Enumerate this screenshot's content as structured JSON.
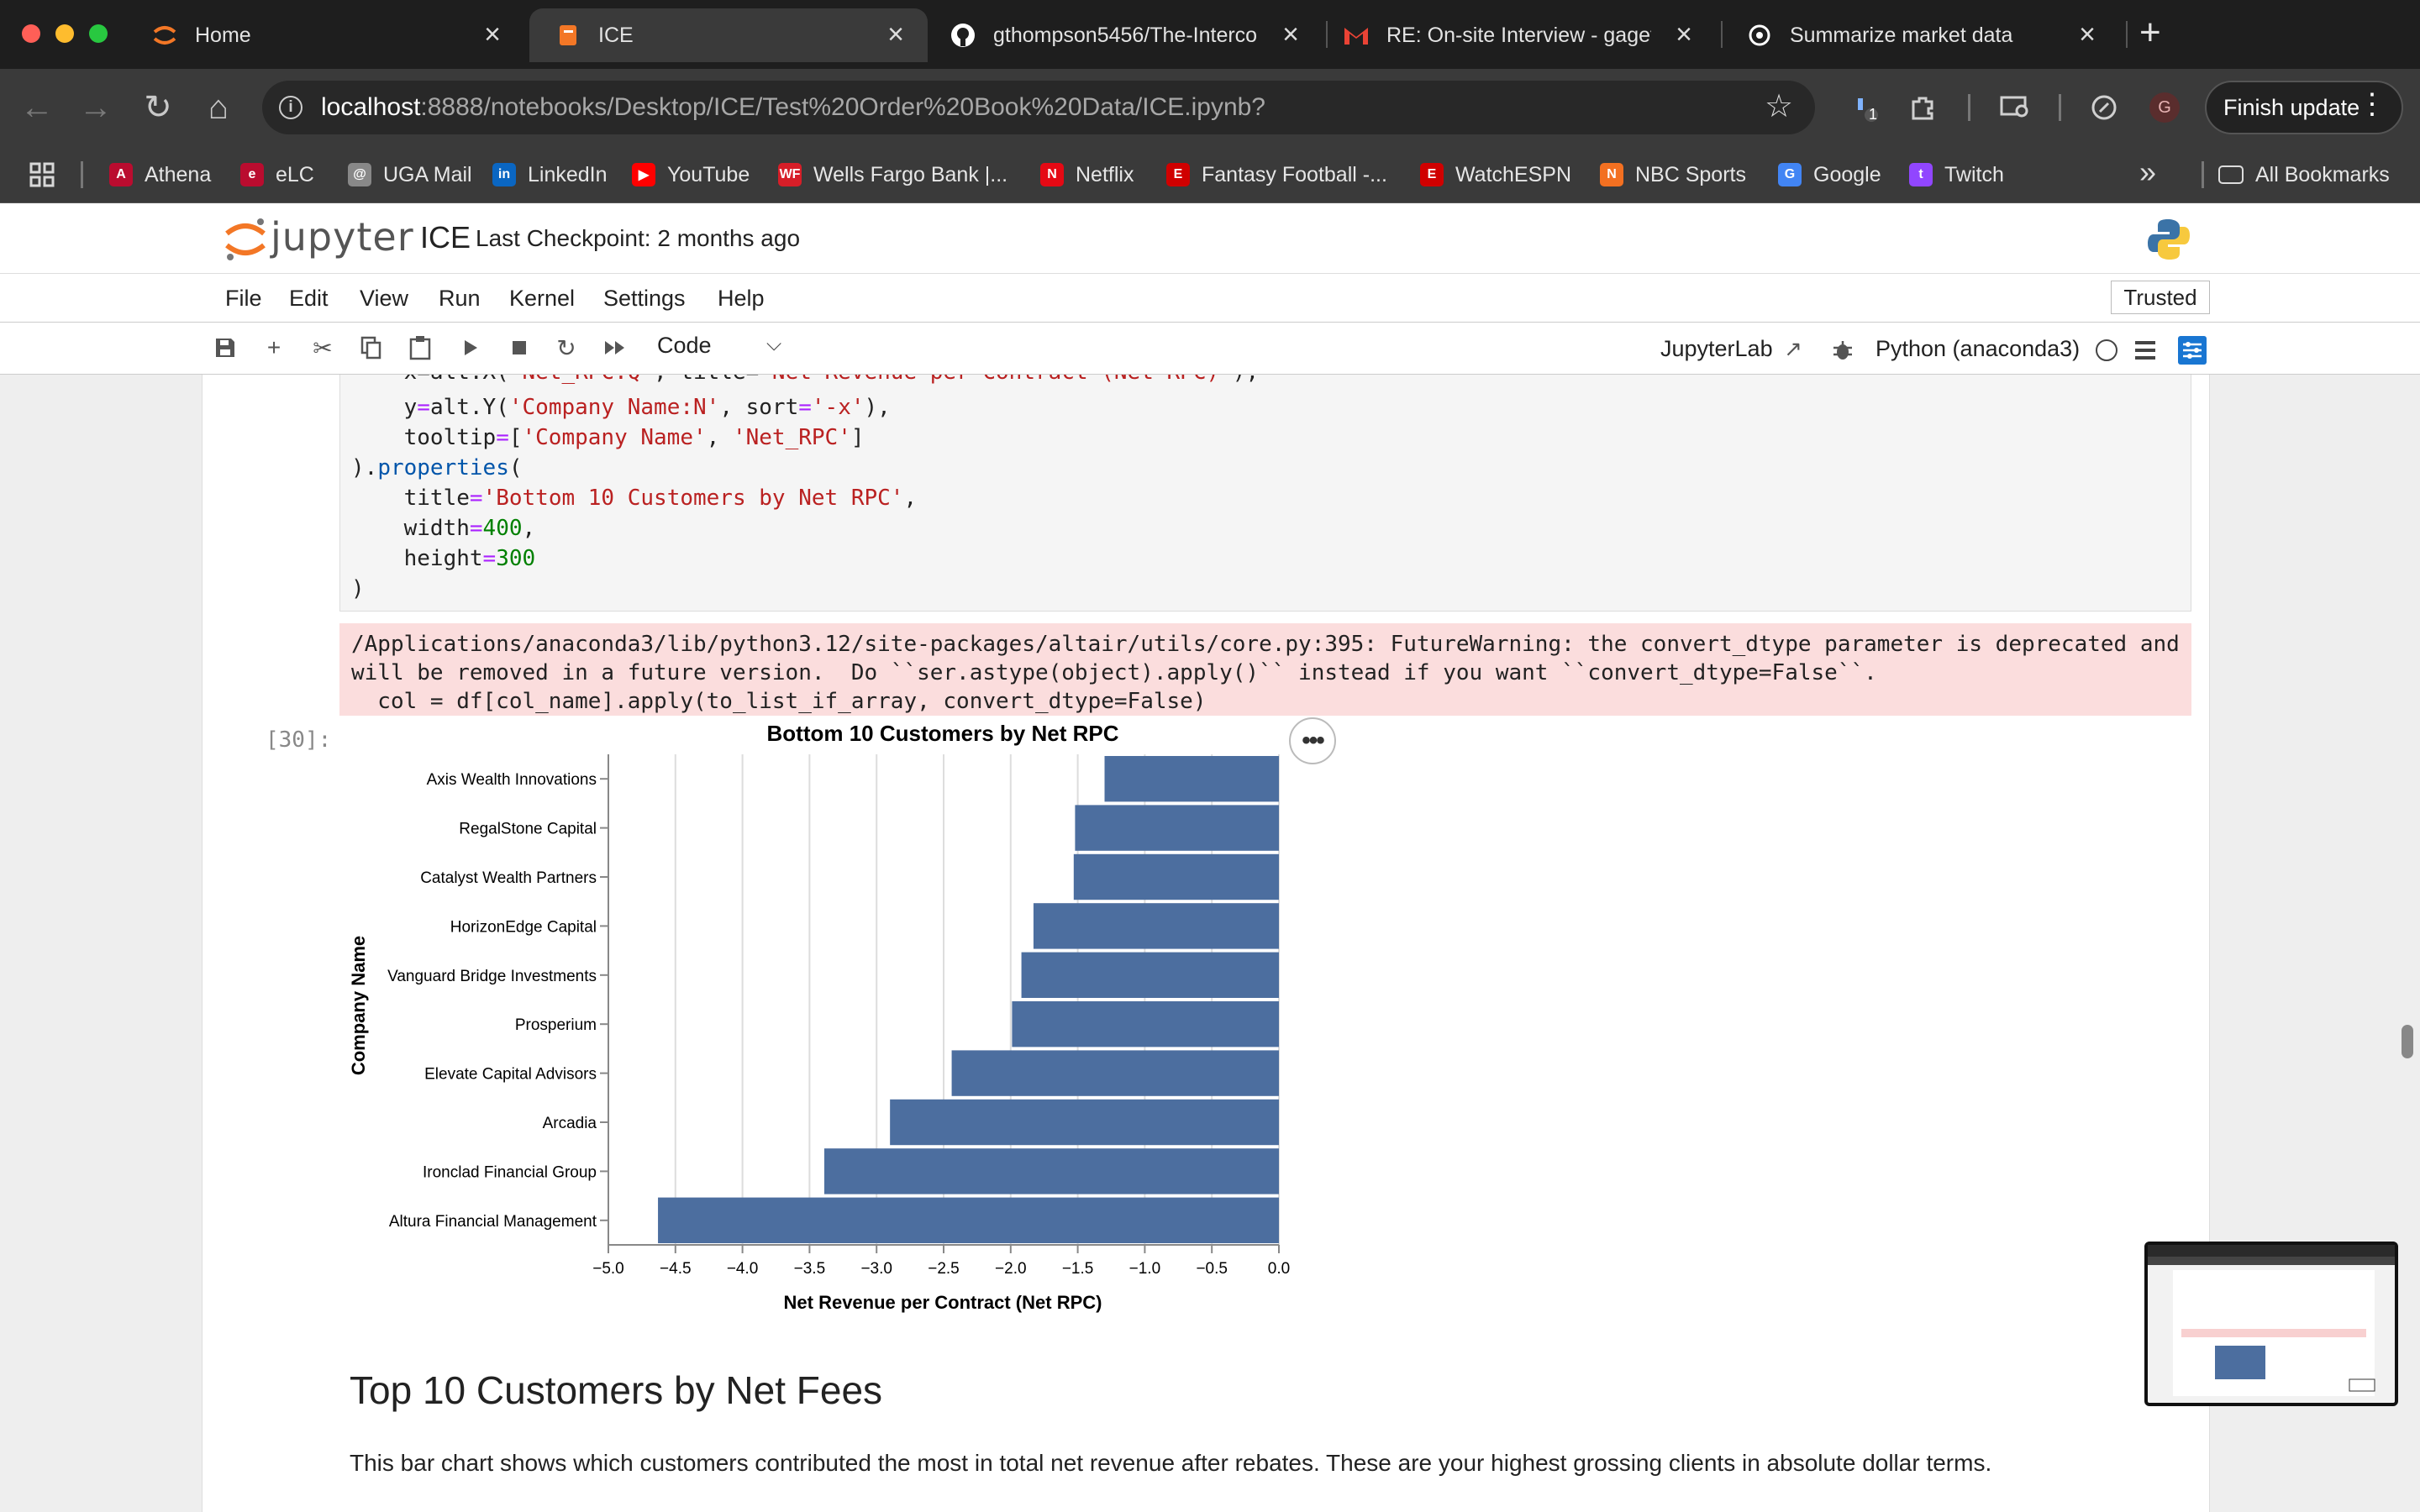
{
  "browser": {
    "tabs": [
      {
        "label": "Home",
        "icon": "jupyter-icon"
      },
      {
        "label": "ICE",
        "icon": "notebook-icon"
      },
      {
        "label": "gthompson5456/The-Interco",
        "icon": "github-icon"
      },
      {
        "label": "RE: On-site Interview - gaget",
        "icon": "gmail-icon"
      },
      {
        "label": "Summarize market data",
        "icon": "chatgpt-icon"
      }
    ],
    "new_tab": "+",
    "close_glyph": "×",
    "url_host": "localhost",
    "url_path": ":8888/notebooks/Desktop/ICE/Test%20Order%20Book%20Data/ICE.ipynb?",
    "extension_badge": "1",
    "profile_initial": "G",
    "finish_update": "Finish update",
    "bookmarks": [
      {
        "label": "Athena",
        "color": "#ba0c2f",
        "glyph": "A"
      },
      {
        "label": "eLC",
        "color": "#ba0c2f",
        "glyph": "e"
      },
      {
        "label": "UGA Mail",
        "color": "#888888",
        "glyph": "@"
      },
      {
        "label": "LinkedIn",
        "color": "#0a66c2",
        "glyph": "in"
      },
      {
        "label": "YouTube",
        "color": "#ff0000",
        "glyph": "▶"
      },
      {
        "label": "Wells Fargo Bank |...",
        "color": "#d71e28",
        "glyph": "WF"
      },
      {
        "label": "Netflix",
        "color": "#e50914",
        "glyph": "N"
      },
      {
        "label": "Fantasy Football -...",
        "color": "#d00000",
        "glyph": "E"
      },
      {
        "label": "WatchESPN",
        "color": "#d00000",
        "glyph": "E"
      },
      {
        "label": "NBC Sports",
        "color": "#f37021",
        "glyph": "N"
      },
      {
        "label": "Google",
        "color": "#4285f4",
        "glyph": "G"
      },
      {
        "label": "Twitch",
        "color": "#9146ff",
        "glyph": "t"
      }
    ],
    "more_bookmarks": "»",
    "all_bookmarks": "All Bookmarks"
  },
  "jupyter": {
    "wordmark": "jupyter",
    "notebook_name": "ICE",
    "checkpoint": "Last Checkpoint: 2 months ago",
    "menu": [
      "File",
      "Edit",
      "View",
      "Run",
      "Kernel",
      "Settings",
      "Help"
    ],
    "trusted": "Trusted",
    "cell_type": "Code",
    "jupyterlab_link": "JupyterLab",
    "kernel": "Python (anaconda3)"
  },
  "code_lines": [
    "    x=alt.X('Net_RPC:Q', title='Net Revenue per Contract (Net RPC)'),",
    "    y=alt.Y('Company Name:N', sort='-x'),",
    "    tooltip=['Company Name', 'Net_RPC']",
    ").properties(",
    "    title='Bottom 10 Customers by Net RPC',",
    "    width=400,",
    "    height=300",
    ")"
  ],
  "warning_lines": [
    "/Applications/anaconda3/lib/python3.12/site-packages/altair/utils/core.py:395: FutureWarning: the convert_dtype parameter is deprecated and",
    "will be removed in a future version.  Do ``ser.astype(object).apply()`` instead if you want ``convert_dtype=False``.",
    "  col = df[col_name].apply(to_list_if_array, convert_dtype=False)"
  ],
  "output_prompt": "[30]:",
  "chart_menu": "•••",
  "chart_data": {
    "type": "bar",
    "title": "Bottom 10 Customers by Net RPC",
    "xlabel": "Net Revenue per Contract (Net RPC)",
    "ylabel": "Company Name",
    "orientation": "horizontal",
    "categories": [
      "Axis Wealth Innovations",
      "RegalStone Capital",
      "Catalyst Wealth Partners",
      "HorizonEdge Capital",
      "Vanguard Bridge Investments",
      "Prosperium",
      "Elevate Capital Advisors",
      "Arcadia",
      "Ironclad Financial Group",
      "Altura Financial Management"
    ],
    "values": [
      -1.3,
      -1.52,
      -1.53,
      -1.83,
      -1.92,
      -1.99,
      -2.44,
      -2.9,
      -3.39,
      -4.63
    ],
    "xlim": [
      -5.0,
      0.0
    ],
    "xticks": [
      "−5.0",
      "−4.5",
      "−4.0",
      "−3.5",
      "−3.0",
      "−2.5",
      "−2.0",
      "−1.5",
      "−1.0",
      "−0.5",
      "0.0"
    ],
    "bar_color": "#4c6e9f",
    "grid": true
  },
  "section_heading": "Top 10 Customers by Net Fees",
  "section_text": "This bar chart shows which customers contributed the most in total net revenue after rebates. These are your highest grossing clients in absolute dollar terms."
}
